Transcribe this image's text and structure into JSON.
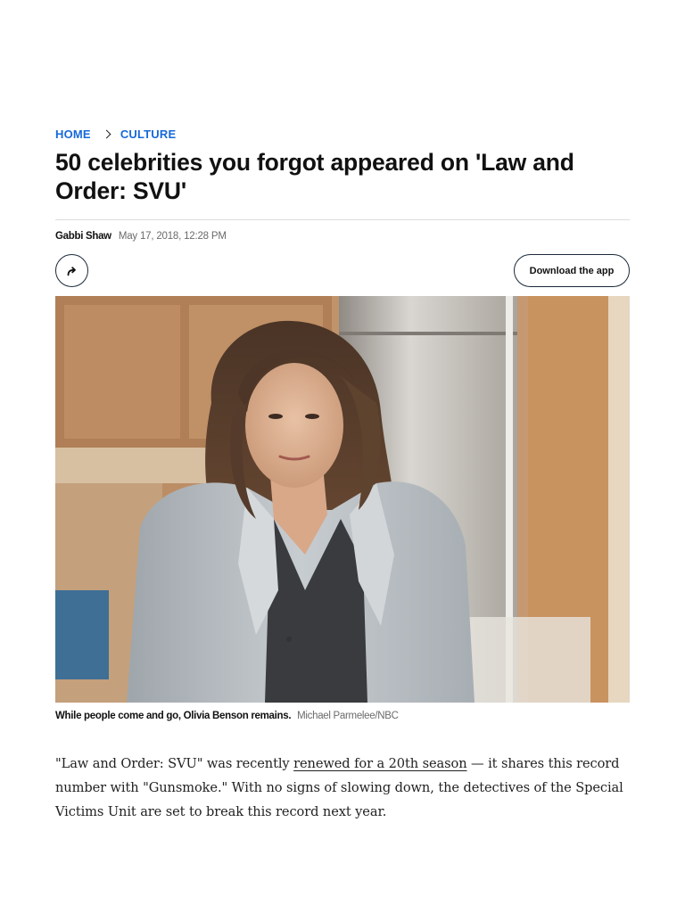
{
  "breadcrumb": {
    "home": "HOME",
    "section": "CULTURE"
  },
  "article": {
    "title": "50 celebrities you forgot appeared on 'Law and Order: SVU'",
    "author": "Gabbi Shaw",
    "date": "May 17, 2018, 12:28 PM"
  },
  "actions": {
    "share_icon": "share-arrow-icon",
    "download_label": "Download the app"
  },
  "hero": {
    "caption": "While people come and go, Olivia Benson remains.",
    "credit": "Michael Parmelee/NBC"
  },
  "body": {
    "p1_before": "\"Law and Order: SVU\" was recently ",
    "p1_link": "renewed for a 20th season",
    "p1_after": " — it shares this record number with \"Gunsmoke.\" With no signs of slowing down, the detectives of the Special Victims Unit are set to break this record next year."
  },
  "colors": {
    "link_blue": "#1769d9",
    "text": "#111111",
    "muted": "#6b6b6b"
  }
}
